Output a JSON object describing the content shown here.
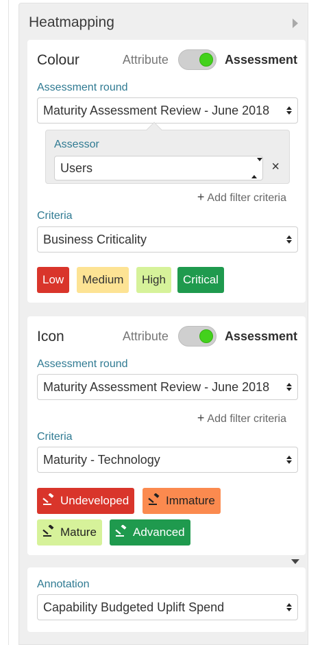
{
  "panel": {
    "title": "Heatmapping"
  },
  "colour_card": {
    "title": "Colour",
    "toggle_left": "Attribute",
    "toggle_right": "Assessment",
    "assessment_round_label": "Assessment round",
    "assessment_round_value": "Maturity Assessment Review - June 2018",
    "assessor_label": "Assessor",
    "assessor_value": "Users",
    "remove_symbol": "×",
    "add_filter": "Add filter criteria",
    "criteria_label": "Criteria",
    "criteria_value": "Business Criticality",
    "chips": [
      {
        "label": "Low",
        "bg": "#d9352b",
        "fg": "#ffffff"
      },
      {
        "label": "Medium",
        "bg": "#fde394",
        "fg": "#333333"
      },
      {
        "label": "High",
        "bg": "#d6f29a",
        "fg": "#333333"
      },
      {
        "label": "Critical",
        "bg": "#1f9a4e",
        "fg": "#ffffff"
      }
    ]
  },
  "icon_card": {
    "title": "Icon",
    "toggle_left": "Attribute",
    "toggle_right": "Assessment",
    "assessment_round_label": "Assessment round",
    "assessment_round_value": "Maturity Assessment Review - June 2018",
    "add_filter": "Add filter criteria",
    "criteria_label": "Criteria",
    "criteria_value": "Maturity - Technology",
    "chips": [
      {
        "label": "Undeveloped",
        "bg": "#d9352b",
        "fg": "#ffffff",
        "icon": "gavel-icon"
      },
      {
        "label": "Immature",
        "bg": "#fb8a4f",
        "fg": "#222222",
        "icon": "gavel-icon"
      },
      {
        "label": "Mature",
        "bg": "#d6f29a",
        "fg": "#222222",
        "icon": "gavel-icon"
      },
      {
        "label": "Advanced",
        "bg": "#1f9a4e",
        "fg": "#ffffff",
        "icon": "gavel-icon"
      }
    ]
  },
  "annotation_card": {
    "label": "Annotation",
    "value": "Capability Budgeted Uplift Spend"
  },
  "colors": {
    "accent_label": "#2f7a92",
    "toggle_on": "#43d11c"
  }
}
